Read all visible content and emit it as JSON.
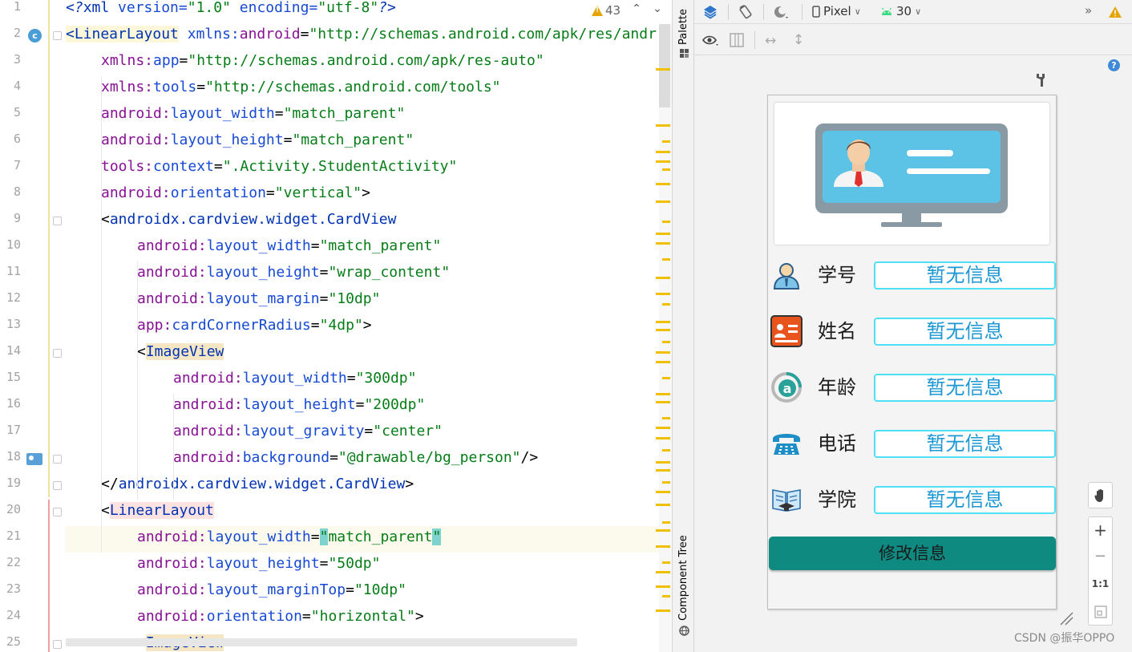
{
  "editor": {
    "warning_count": "43",
    "lines": [
      {
        "n": "1"
      },
      {
        "n": "2"
      },
      {
        "n": "3"
      },
      {
        "n": "4"
      },
      {
        "n": "5"
      },
      {
        "n": "6"
      },
      {
        "n": "7"
      },
      {
        "n": "8"
      },
      {
        "n": "9"
      },
      {
        "n": "10"
      },
      {
        "n": "11"
      },
      {
        "n": "12"
      },
      {
        "n": "13"
      },
      {
        "n": "14"
      },
      {
        "n": "15"
      },
      {
        "n": "16"
      },
      {
        "n": "17"
      },
      {
        "n": "18"
      },
      {
        "n": "19"
      },
      {
        "n": "20"
      },
      {
        "n": "21"
      },
      {
        "n": "22"
      },
      {
        "n": "23"
      },
      {
        "n": "24"
      },
      {
        "n": "25"
      }
    ],
    "gutter_badge": "c",
    "code": {
      "l1": {
        "a": "<?",
        "b": "xml",
        "c": " version=",
        "d": "\"1.0\"",
        "e": " encoding=",
        "f": "\"utf-8\"",
        "g": "?>"
      },
      "l2": {
        "tag": "<LinearLayout",
        "ns": " xmlns:",
        "attr": "android",
        "eq": "=",
        "val": "\"http://schemas.android.com/apk/res/andr"
      },
      "l3": {
        "ns": "xmlns:",
        "attr": "app",
        "eq": "=",
        "val": "\"http://schemas.android.com/apk/res-auto\""
      },
      "l4": {
        "ns": "xmlns:",
        "attr": "tools",
        "eq": "=",
        "val": "\"http://schemas.android.com/tools\""
      },
      "l5": {
        "ns": "android:",
        "attr": "layout_width",
        "eq": "=",
        "val": "\"match_parent\""
      },
      "l6": {
        "ns": "android:",
        "attr": "layout_height",
        "eq": "=",
        "val": "\"match_parent\""
      },
      "l7": {
        "ns": "tools:",
        "attr": "context",
        "eq": "=",
        "val": "\".Activity.StudentActivity\""
      },
      "l8": {
        "ns": "android:",
        "attr": "orientation",
        "eq": "=",
        "val": "\"vertical\"",
        "end": ">"
      },
      "l9": {
        "lt": "<",
        "tag": "androidx.cardview.widget.CardView"
      },
      "l10": {
        "ns": "android:",
        "attr": "layout_width",
        "eq": "=",
        "val": "\"match_parent\""
      },
      "l11": {
        "ns": "android:",
        "attr": "layout_height",
        "eq": "=",
        "val": "\"wrap_content\""
      },
      "l12": {
        "ns": "android:",
        "attr": "layout_margin",
        "eq": "=",
        "val": "\"10dp\""
      },
      "l13": {
        "ns": "app:",
        "attr": "cardCornerRadius",
        "eq": "=",
        "val": "\"4dp\"",
        "end": ">"
      },
      "l14": {
        "lt": "<",
        "tag": "ImageView"
      },
      "l15": {
        "ns": "android:",
        "attr": "layout_width",
        "eq": "=",
        "val": "\"300dp\""
      },
      "l16": {
        "ns": "android:",
        "attr": "layout_height",
        "eq": "=",
        "val": "\"200dp\""
      },
      "l17": {
        "ns": "android:",
        "attr": "layout_gravity",
        "eq": "=",
        "val": "\"center\""
      },
      "l18": {
        "ns": "android:",
        "attr": "background",
        "eq": "=",
        "val": "\"@drawable/bg_person\"",
        "end": "/>"
      },
      "l19": {
        "lt": "</",
        "tag": "androidx.cardview.widget.CardView",
        "end": ">"
      },
      "l20": {
        "lt": "<",
        "tag": "LinearLayout"
      },
      "l21": {
        "ns": "android:",
        "attr": "layout_width",
        "eq": "=",
        "q1": "\"",
        "val": "match_parent",
        "q2": "\""
      },
      "l22": {
        "ns": "android:",
        "attr": "layout_height",
        "eq": "=",
        "val": "\"50dp\""
      },
      "l23": {
        "ns": "android:",
        "attr": "layout_marginTop",
        "eq": "=",
        "val": "\"10dp\""
      },
      "l24": {
        "ns": "android:",
        "attr": "orientation",
        "eq": "=",
        "val": "\"horizontal\"",
        "end": ">"
      },
      "l25": {
        "lt": "<",
        "tag": "ImageView"
      }
    }
  },
  "side_tabs": {
    "palette": "Palette",
    "component_tree": "Component Tree"
  },
  "design_toolbar": {
    "device": "Pixel",
    "api": "30",
    "overflow": "»",
    "help": "?"
  },
  "phone": {
    "rows": [
      {
        "label": "学号",
        "value": "暂无信息",
        "icon": "student-id-person-icon"
      },
      {
        "label": "姓名",
        "value": "暂无信息",
        "icon": "name-card-icon"
      },
      {
        "label": "年龄",
        "value": "暂无信息",
        "icon": "age-a-icon"
      },
      {
        "label": "电话",
        "value": "暂无信息",
        "icon": "telephone-icon"
      },
      {
        "label": "学院",
        "value": "暂无信息",
        "icon": "college-book-icon"
      }
    ],
    "edit_button": "修改信息"
  },
  "zoom": {
    "plus": "+",
    "minus": "−",
    "one_to_one": "1:1"
  },
  "watermark": "CSDN @振华OPPO",
  "colors": {
    "accent_teal": "#0e8a80",
    "field_border": "#4ee0f4",
    "field_text": "#1b97d4",
    "warning": "#e5a400"
  }
}
